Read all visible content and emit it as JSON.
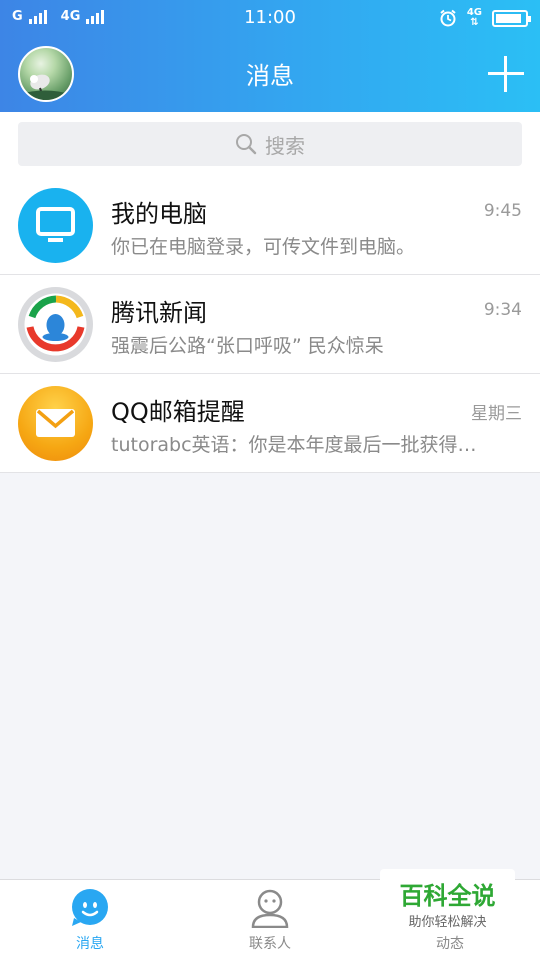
{
  "status_bar": {
    "carrier_1": "G",
    "carrier_2": "4G",
    "time": "11:00",
    "network": "4G",
    "battery_level_percent": 90
  },
  "header": {
    "title": "消息"
  },
  "search": {
    "placeholder": "搜索"
  },
  "conversations": [
    {
      "name": "我的电脑",
      "time": "9:45",
      "preview": "你已在电脑登录，可传文件到电脑。",
      "icon": "computer-icon"
    },
    {
      "name": "腾讯新闻",
      "time": "9:34",
      "preview": "强震后公路“张口呼吸” 民众惊呆",
      "icon": "tencent-news-icon"
    },
    {
      "name": "QQ邮箱提醒",
      "time": "星期三",
      "preview": "tutorabc英语：你是本年度最后一批获得…",
      "icon": "mail-icon"
    }
  ],
  "tabs": [
    {
      "label": "消息",
      "active": true
    },
    {
      "label": "联系人",
      "active": false
    },
    {
      "label": "动态",
      "active": false
    }
  ],
  "watermark": {
    "title": "百科全说",
    "subtitle": "助你轻松解决"
  },
  "colors": {
    "header_gradient_start": "#3d85e6",
    "header_gradient_end": "#2bbff5",
    "accent": "#29a7f2",
    "watermark_green": "#2ea834"
  }
}
